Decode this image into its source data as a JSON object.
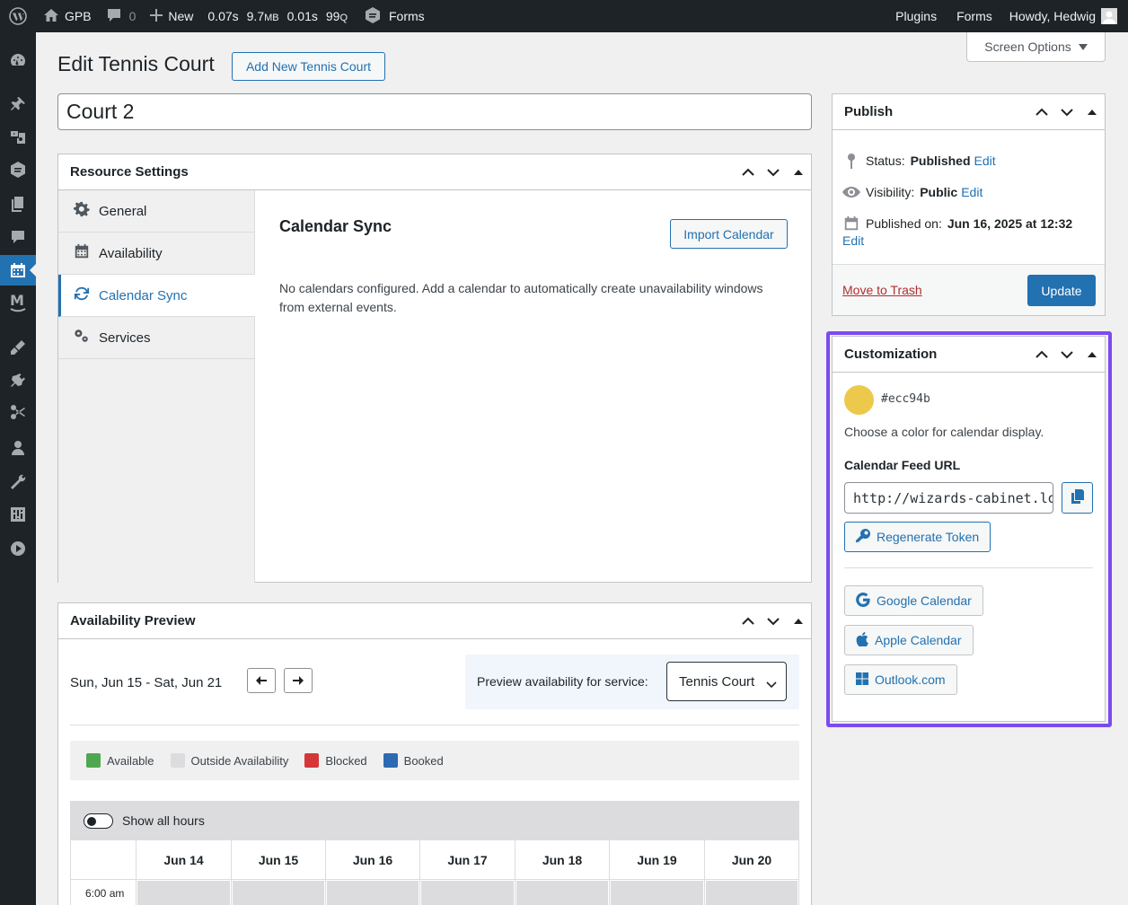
{
  "admin_bar": {
    "site_name": "GPB",
    "comments_count": "0",
    "new_label": "New",
    "perf_time": "0.07s",
    "perf_mem": "9.7",
    "perf_mem_unit": "MB",
    "perf_query_time": "0.01s",
    "perf_queries": "99",
    "perf_queries_unit": "Q",
    "forms_label": "Forms",
    "right_items": [
      "Plugins",
      "Forms"
    ],
    "howdy": "Howdy, Hedwig"
  },
  "screen_options": "Screen Options",
  "page": {
    "title": "Edit Tennis Court",
    "add_new_label": "Add New Tennis Court",
    "post_title": "Court 2"
  },
  "resource_settings": {
    "title": "Resource Settings",
    "tabs": [
      {
        "label": "General",
        "icon": "gear-icon"
      },
      {
        "label": "Availability",
        "icon": "calendar-icon"
      },
      {
        "label": "Calendar Sync",
        "icon": "sync-icon"
      },
      {
        "label": "Services",
        "icon": "gears-icon"
      }
    ],
    "active_tab": "Calendar Sync",
    "section_title": "Calendar Sync",
    "import_label": "Import Calendar",
    "description": "No calendars configured. Add a calendar to automatically create unavailability windows from external events."
  },
  "publish": {
    "title": "Publish",
    "status_label": "Status:",
    "status_value": "Published",
    "visibility_label": "Visibility:",
    "visibility_value": "Public",
    "published_label": "Published on:",
    "published_value": "Jun 16, 2025 at 12:32",
    "edit_label": "Edit",
    "trash_label": "Move to Trash",
    "update_label": "Update"
  },
  "customization": {
    "title": "Customization",
    "color": "#ecc94b",
    "color_text": "#ecc94b",
    "color_description": "Choose a color for calendar display.",
    "feed_label": "Calendar Feed URL",
    "feed_value": "http://wizards-cabinet.lo",
    "regenerate_label": "Regenerate Token",
    "google_label": "Google Calendar",
    "apple_label": "Apple Calendar",
    "outlook_label": "Outlook.com",
    "highlight_color": "#7b4bf0"
  },
  "availability_preview": {
    "title": "Availability Preview",
    "range": "Sun, Jun 15 - Sat, Jun 21",
    "service_label": "Preview availability for service:",
    "service_value": "Tennis Court",
    "legend": [
      {
        "label": "Available",
        "color": "#4fa84f"
      },
      {
        "label": "Outside Availability",
        "color": "#dcdcde"
      },
      {
        "label": "Blocked",
        "color": "#d63638"
      },
      {
        "label": "Booked",
        "color": "#2c6ab1"
      }
    ],
    "show_all_hours": "Show all hours",
    "days": [
      "Jun 14",
      "Jun 15",
      "Jun 16",
      "Jun 17",
      "Jun 18",
      "Jun 19",
      "Jun 20"
    ],
    "first_time": "6:00 am"
  }
}
